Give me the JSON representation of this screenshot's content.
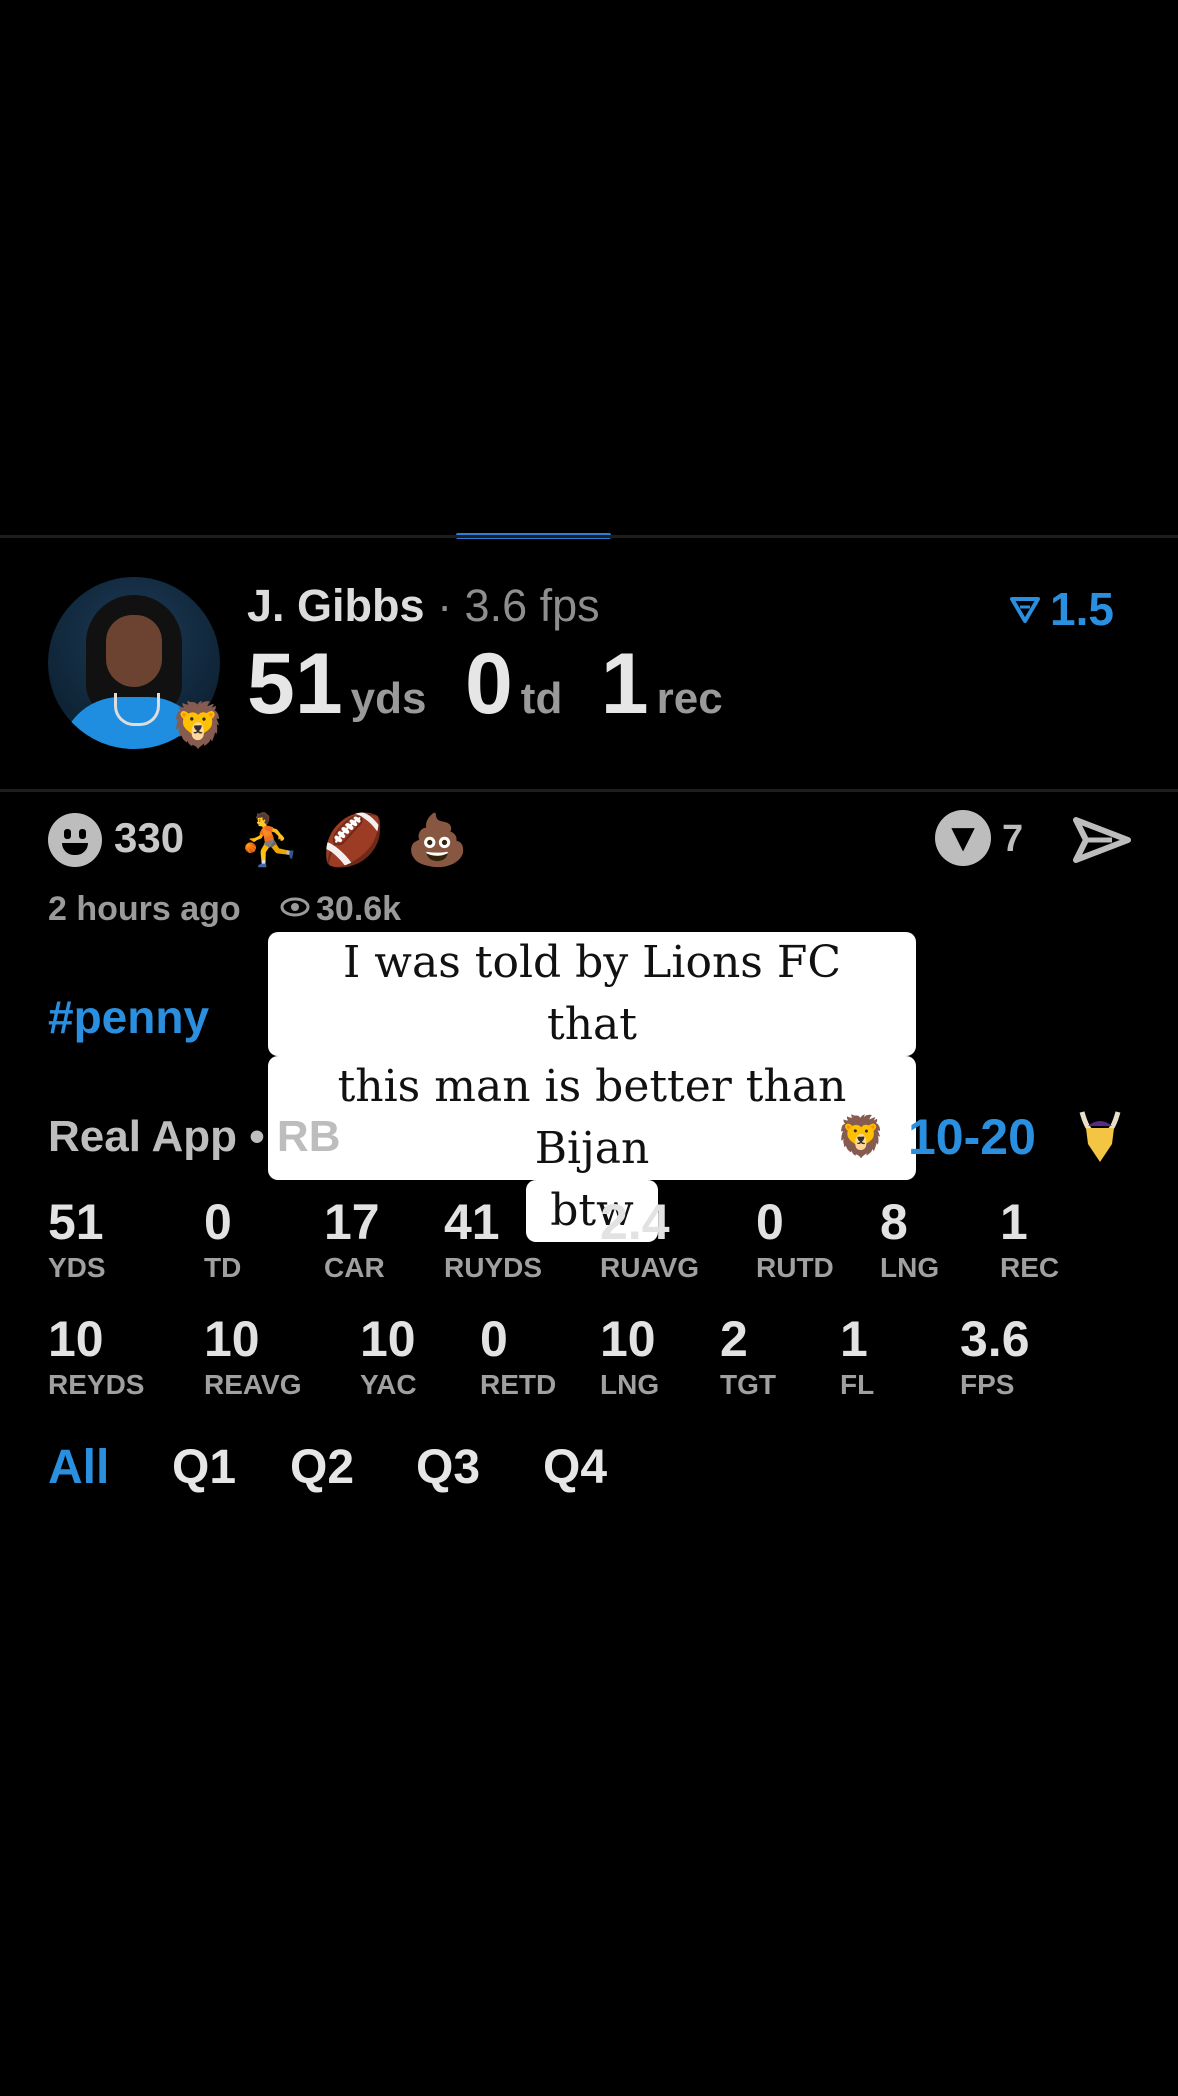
{
  "player": {
    "name": "J. Gibbs",
    "fps_text": "· 3.6 fps",
    "line_value": "1.5"
  },
  "headline_stats": [
    {
      "value": "51",
      "unit": "yds"
    },
    {
      "value": "0",
      "unit": "td"
    },
    {
      "value": "1",
      "unit": "rec"
    }
  ],
  "reactions": {
    "count": "330",
    "votes": "7"
  },
  "meta": {
    "time": "2 hours ago",
    "views": "30.6k"
  },
  "hashtag": "#penny",
  "caption": [
    "I was told by Lions FC that",
    "this man is better than Bijan",
    "btw"
  ],
  "section": {
    "title": "Real App • RB",
    "score": "10-20"
  },
  "stats_row1": [
    {
      "value": "51",
      "label": "YDS"
    },
    {
      "value": "0",
      "label": "TD"
    },
    {
      "value": "17",
      "label": "CAR"
    },
    {
      "value": "41",
      "label": "RUYDS"
    },
    {
      "value": "2.4",
      "label": "RUAVG"
    },
    {
      "value": "0",
      "label": "RUTD"
    },
    {
      "value": "8",
      "label": "LNG"
    },
    {
      "value": "1",
      "label": "REC"
    }
  ],
  "stats_row2": [
    {
      "value": "10",
      "label": "REYDS"
    },
    {
      "value": "10",
      "label": "REAVG"
    },
    {
      "value": "10",
      "label": "YAC"
    },
    {
      "value": "0",
      "label": "RETD"
    },
    {
      "value": "10",
      "label": "LNG"
    },
    {
      "value": "2",
      "label": "TGT"
    },
    {
      "value": "1",
      "label": "FL"
    },
    {
      "value": "3.6",
      "label": "FPS"
    }
  ],
  "quarter_tabs": [
    "All",
    "Q1",
    "Q2",
    "Q3",
    "Q4"
  ],
  "colors": {
    "accent": "#2b8fe0",
    "background": "#000000"
  }
}
